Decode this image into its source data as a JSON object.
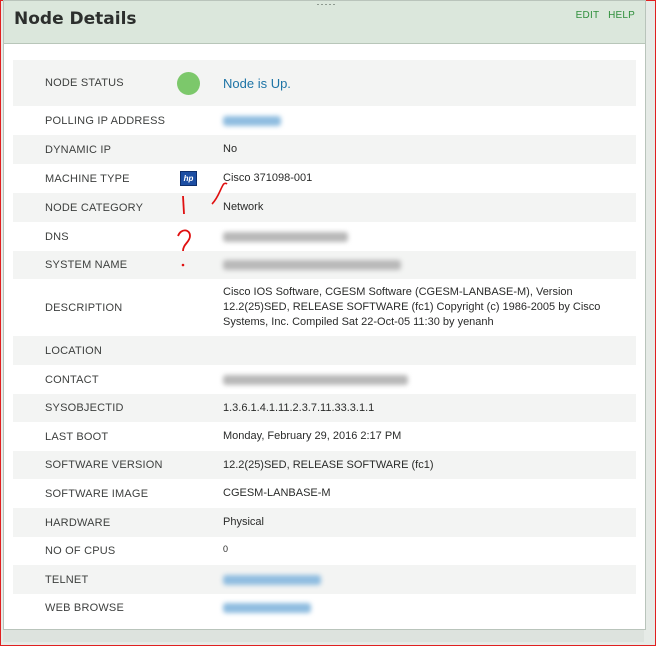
{
  "panel": {
    "title": "Node Details",
    "actions": [
      "EDIT",
      "HELP"
    ]
  },
  "rows": [
    {
      "label": "NODE STATUS",
      "value": "Node is Up.",
      "status_color": "#7cc86b"
    },
    {
      "label": "POLLING IP ADDRESS",
      "value": "",
      "redacted": true
    },
    {
      "label": "DYNAMIC IP",
      "value": "No"
    },
    {
      "label": "MACHINE TYPE",
      "value": "Cisco 371098-001",
      "icon": "hp-logo-icon"
    },
    {
      "label": "NODE CATEGORY",
      "value": "Network"
    },
    {
      "label": "DNS",
      "value": "",
      "redacted": true
    },
    {
      "label": "SYSTEM NAME",
      "value": "",
      "redacted": true
    },
    {
      "label": "DESCRIPTION",
      "value": "Cisco IOS Software, CGESM Software (CGESM-LANBASE-M), Version 12.2(25)SED, RELEASE SOFTWARE (fc1) Copyright (c) 1986-2005 by Cisco Systems, Inc. Compiled Sat 22-Oct-05 11:30 by yenanh"
    },
    {
      "label": "LOCATION",
      "value": ""
    },
    {
      "label": "CONTACT",
      "value": "",
      "redacted": true
    },
    {
      "label": "SYSOBJECTID",
      "value": "1.3.6.1.4.1.11.2.3.7.11.33.3.1.1"
    },
    {
      "label": "LAST BOOT",
      "value": "Monday, February 29, 2016 2:17 PM"
    },
    {
      "label": "SOFTWARE VERSION",
      "value": "12.2(25)SED, RELEASE SOFTWARE (fc1)"
    },
    {
      "label": "SOFTWARE IMAGE",
      "value": "CGESM-LANBASE-M"
    },
    {
      "label": "HARDWARE",
      "value": "Physical"
    },
    {
      "label": "NO OF CPUS",
      "value": "0"
    },
    {
      "label": "TELNET",
      "value": "",
      "redacted": true
    },
    {
      "label": "WEB BROWSE",
      "value": "",
      "redacted": true
    }
  ],
  "colors": {
    "header_bg": "#dbe7dc",
    "link": "#1d74a6",
    "action": "#2f8f3c",
    "status_up": "#7cc86b",
    "annotation": "#e01010"
  }
}
